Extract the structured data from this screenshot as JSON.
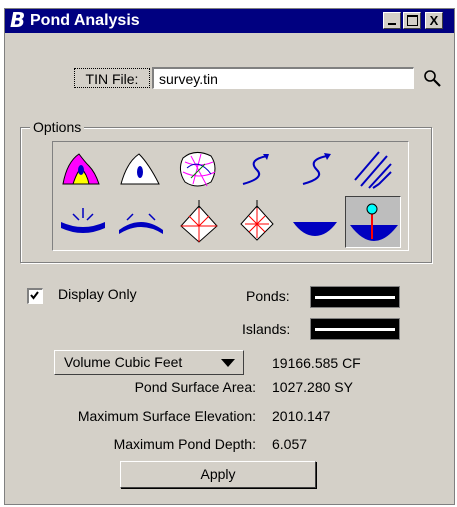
{
  "window": {
    "title": "Pond Analysis",
    "close_glyph": "X"
  },
  "tin": {
    "label": "TIN File:",
    "value": "survey.tin"
  },
  "options": {
    "legend": "Options",
    "tools": [
      {
        "icon": "pond-catchment-icon"
      },
      {
        "icon": "pond-icon"
      },
      {
        "icon": "contour-map-icon"
      },
      {
        "icon": "flow-path-icon"
      },
      {
        "icon": "flow-trace-icon"
      },
      {
        "icon": "flow-arrows-icon"
      },
      {
        "icon": "sink-icon"
      },
      {
        "icon": "ridge-icon"
      },
      {
        "icon": "watershed-icon"
      },
      {
        "icon": "drainage-icon"
      },
      {
        "icon": "pond-surface-icon"
      },
      {
        "icon": "pond-depth-icon",
        "active": true
      }
    ]
  },
  "display_only": {
    "label": "Display Only",
    "checked": true
  },
  "ponds": {
    "label": "Ponds:"
  },
  "islands": {
    "label": "Islands:"
  },
  "volume": {
    "unit": "Volume Cubic Feet",
    "value": "19166.585 CF"
  },
  "surface_area": {
    "label": "Pond Surface Area:",
    "value": "1027.280 SY"
  },
  "max_elevation": {
    "label": "Maximum Surface Elevation:",
    "value": "2010.147"
  },
  "max_depth": {
    "label": "Maximum Pond Depth:",
    "value": "6.057"
  },
  "apply_label": "Apply",
  "colors": {
    "titlebar": "#000080",
    "face": "#d4d0c8",
    "pond_blue": "#0000c0",
    "magenta": "#ff00ff",
    "yellow": "#ffff00"
  }
}
